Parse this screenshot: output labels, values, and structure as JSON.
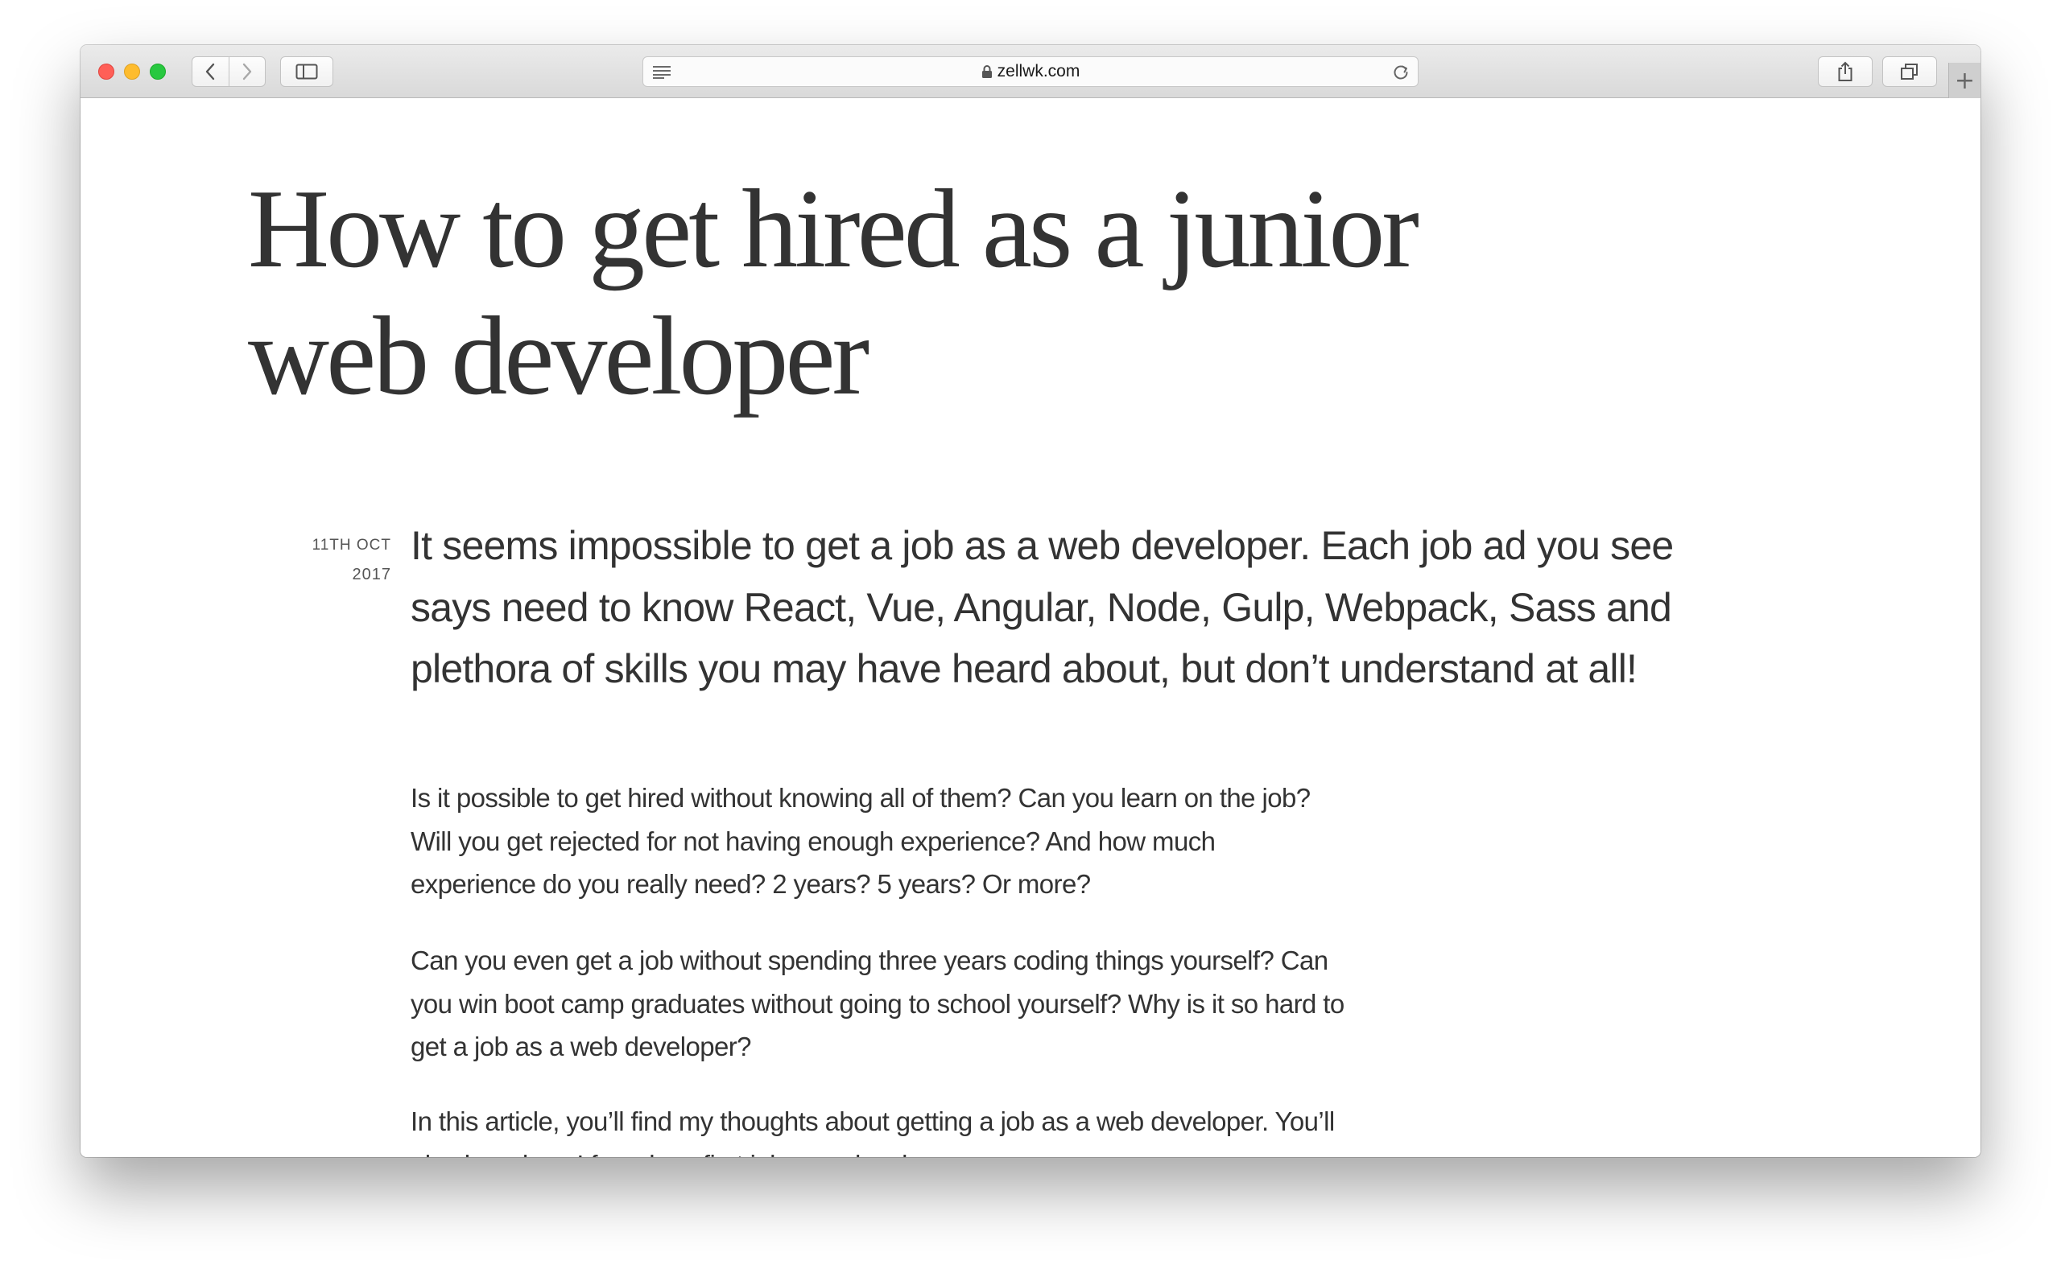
{
  "browser": {
    "url": "zellwk.com",
    "new_tab_label": "+"
  },
  "article": {
    "title": "How to get hired as a junior web developer",
    "date_line1": "11TH OCT",
    "date_line2": "2017",
    "lead": "It seems impossible to get a job as a web developer. Each job ad you see says need to know React, Vue, Angular, Node, Gulp, Webpack, Sass and plethora of skills you may have heard about, but don’t understand at all!",
    "paragraphs": [
      "Is it possible to get hired without knowing all of them? Can you learn on the job? Will you get rejected for not having enough experience? And how much experience do you really need? 2 years? 5 years? Or more?",
      "Can you even get a job without spending three years coding things yourself? Can you win boot camp graduates without going to school yourself? Why is it so hard to get a job as a web developer?",
      "In this article, you’ll find my thoughts about getting a job as a web developer. You’ll also hear how I found my first job as a developer."
    ]
  },
  "colors": {
    "text": "#333333",
    "close": "#ff5f57",
    "minimize": "#febc2e",
    "maximize": "#28c840"
  },
  "icons": [
    "close-icon",
    "minimize-icon",
    "maximize-icon",
    "chevron-left-icon",
    "chevron-right-icon",
    "sidebar-icon",
    "reader-icon",
    "lock-icon",
    "reload-icon",
    "share-icon",
    "tabs-icon",
    "plus-icon"
  ]
}
